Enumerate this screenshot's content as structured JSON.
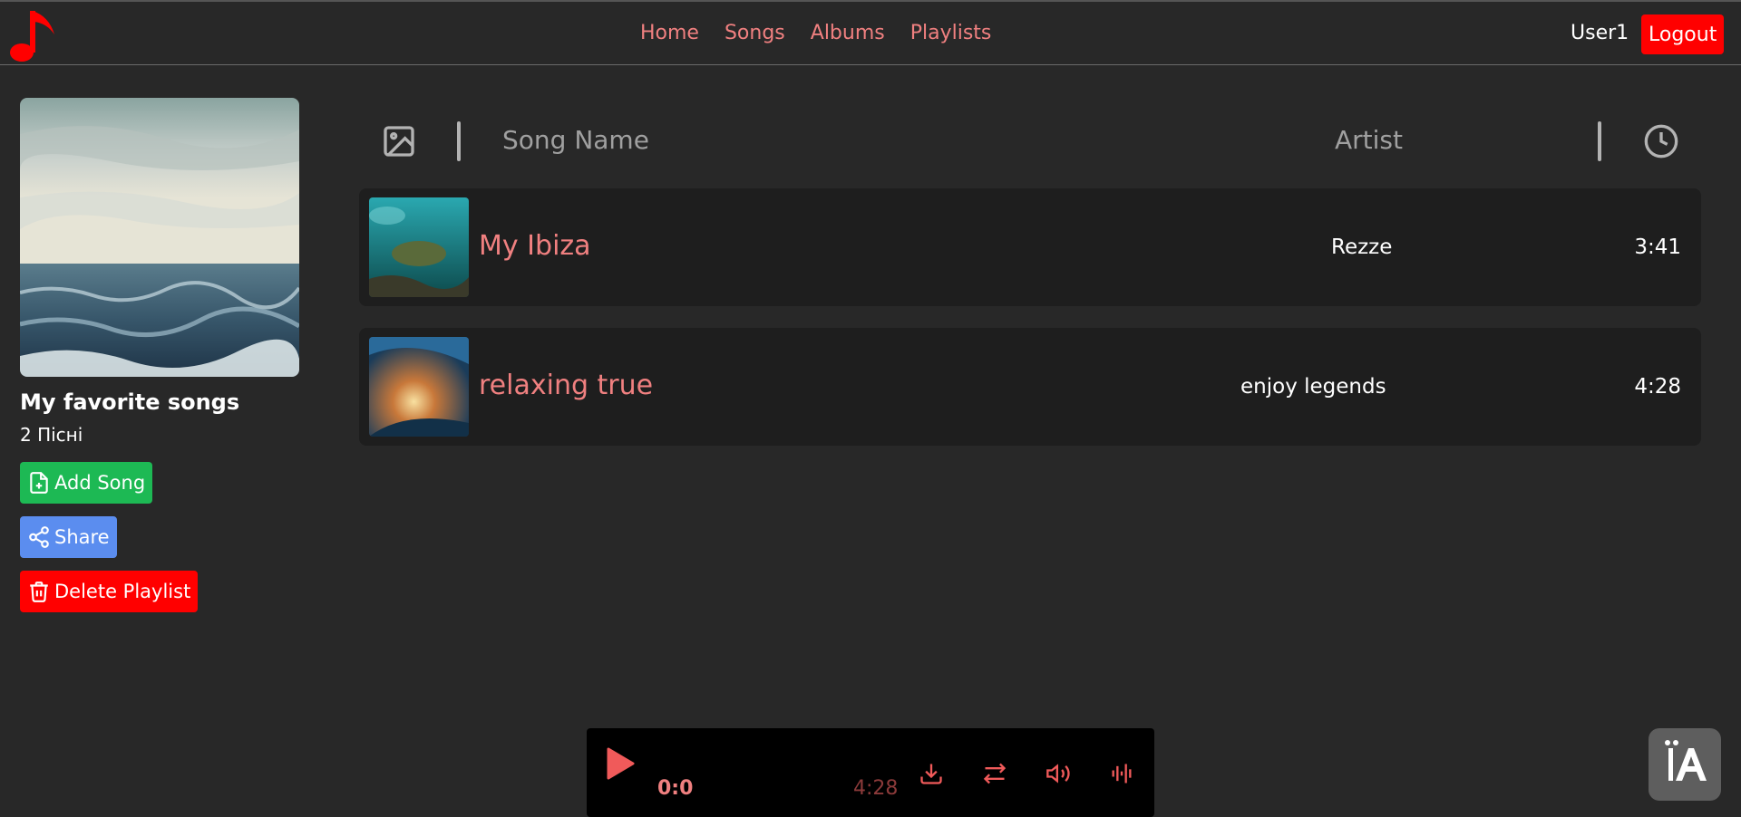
{
  "nav": {
    "home": "Home",
    "songs": "Songs",
    "albums": "Albums",
    "playlists": "Playlists"
  },
  "user": {
    "name": "User1",
    "logout_label": "Logout"
  },
  "playlist": {
    "title": "My favorite songs",
    "count": "2 Пісні",
    "add_label": "Add Song",
    "share_label": "Share",
    "delete_label": "Delete Playlist"
  },
  "table": {
    "col_name": "Song Name",
    "col_artist": "Artist"
  },
  "songs": [
    {
      "title": "My Ibiza",
      "artist": "Rezze",
      "duration": "3:41"
    },
    {
      "title": "relaxing true",
      "artist": "enjoy legends",
      "duration": "4:28"
    }
  ],
  "player": {
    "current_time": "0:0",
    "total_time": "4:28"
  },
  "colors": {
    "accent": "#f08080",
    "background": "#282828",
    "row": "#1e1e1e",
    "add": "#1db954",
    "share": "#5b8def",
    "danger": "#ff0000"
  },
  "icons": [
    "music-note-icon",
    "image-icon",
    "clock-icon",
    "file-plus-icon",
    "share-icon",
    "trash-icon",
    "play-icon",
    "download-icon",
    "repeat-icon",
    "volume-icon",
    "waveform-icon",
    "translate-icon"
  ]
}
